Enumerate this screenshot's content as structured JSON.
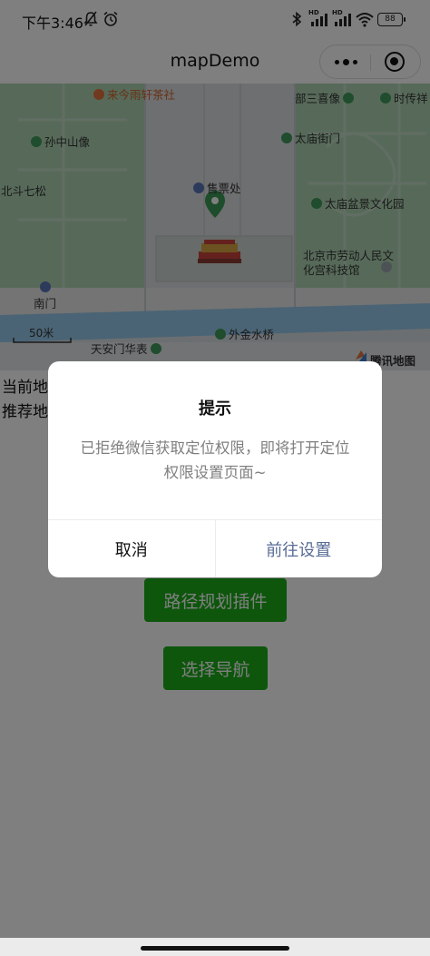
{
  "status_bar": {
    "time": "下午3:46",
    "battery": "88",
    "network_labels": [
      "HD",
      "HD"
    ],
    "icons": [
      "mute-bell-icon",
      "alarm-icon",
      "bluetooth-icon",
      "signal-icon",
      "signal-icon",
      "wifi-icon",
      "battery-icon"
    ]
  },
  "nav": {
    "title": "mapDemo",
    "more_icon": "more-dots-icon",
    "close_icon": "close-target-icon"
  },
  "map": {
    "pois": [
      {
        "label": "来今雨轩茶社",
        "icon": "restaurant-icon"
      },
      {
        "label": "部三喜像",
        "icon": "landmark-icon"
      },
      {
        "label": "时传祥",
        "icon": "landmark-icon"
      },
      {
        "label": "孙中山像",
        "icon": "landmark-icon"
      },
      {
        "label": "太庙街门",
        "icon": "landmark-icon"
      },
      {
        "label": "售票处",
        "icon": "ticket-icon"
      },
      {
        "label": "北斗七松",
        "icon": ""
      },
      {
        "label": "太庙盆景文化园",
        "icon": "park-icon"
      },
      {
        "label": "北京市劳动人民文化宫科技馆",
        "icon": "museum-icon"
      },
      {
        "label": "南门",
        "icon": "gate-icon"
      },
      {
        "label": "外金水桥",
        "icon": "landmark-icon"
      },
      {
        "label": "天安门华表",
        "icon": "landmark-icon"
      }
    ],
    "scale_label": "50米",
    "logo_text": "腾讯地图",
    "colors": {
      "green": "#aed4b3",
      "road": "#e6e6e6",
      "water": "#95c9ea",
      "marker": "#3b9b56"
    }
  },
  "page": {
    "text_line_1": "当前地",
    "text_line_2": "推荐地",
    "buttons": {
      "route_plugin": "路径规划插件",
      "select_nav": "选择导航"
    },
    "button_color": "#1aad19"
  },
  "modal": {
    "title": "提示",
    "content": "已拒绝微信获取定位权限，即将打开定位权限设置页面~",
    "cancel": "取消",
    "confirm": "前往设置",
    "confirm_color": "#576b95"
  }
}
